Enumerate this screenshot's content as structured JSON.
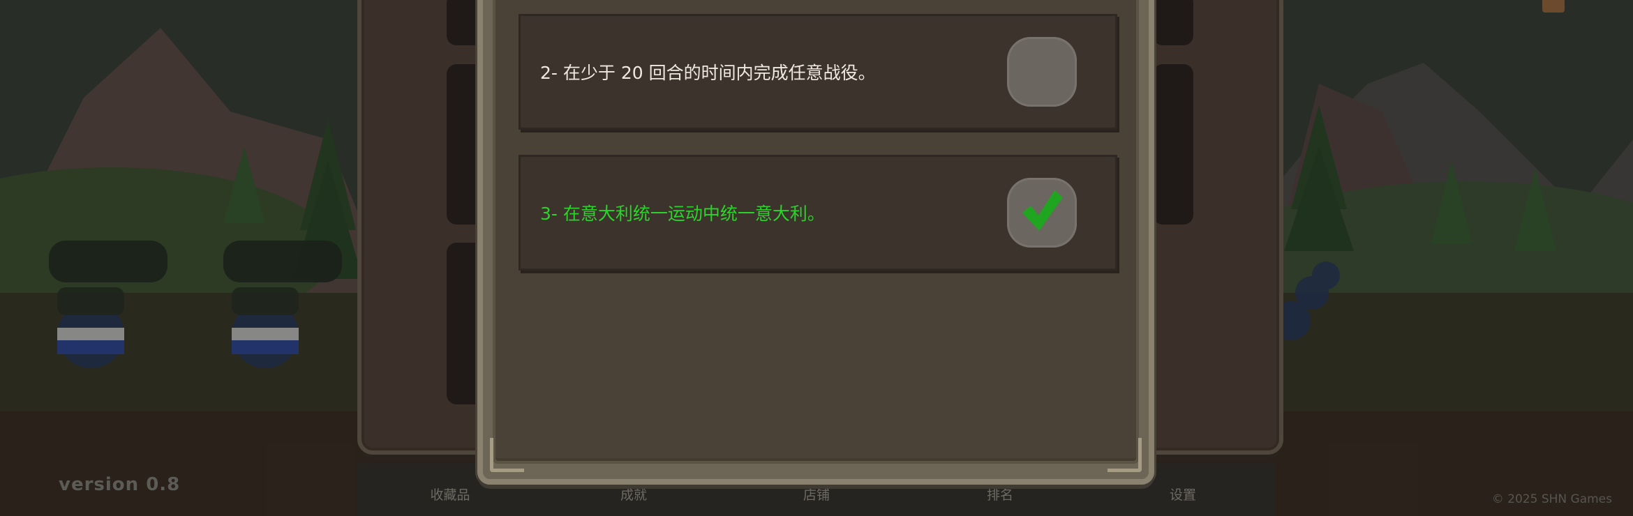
{
  "footer": {
    "version": "version 0.8",
    "copyright": "© 2025 SHN Games"
  },
  "bottom_nav": {
    "items": [
      {
        "label": "收藏品"
      },
      {
        "label": "成就"
      },
      {
        "label": "店铺"
      },
      {
        "label": "排名"
      },
      {
        "label": "设置"
      }
    ]
  },
  "modal": {
    "tasks": [
      {
        "label": "2- 在少于 20 回合的时间内完成任意战役。",
        "completed": false
      },
      {
        "label": "3- 在意大利统一运动中统一意大利。",
        "completed": true
      }
    ]
  },
  "colors": {
    "completed_text": "#2bd32b",
    "check_mark": "#1fa51f",
    "task_text": "#efe9df"
  },
  "icons": {
    "check": "check-icon"
  }
}
